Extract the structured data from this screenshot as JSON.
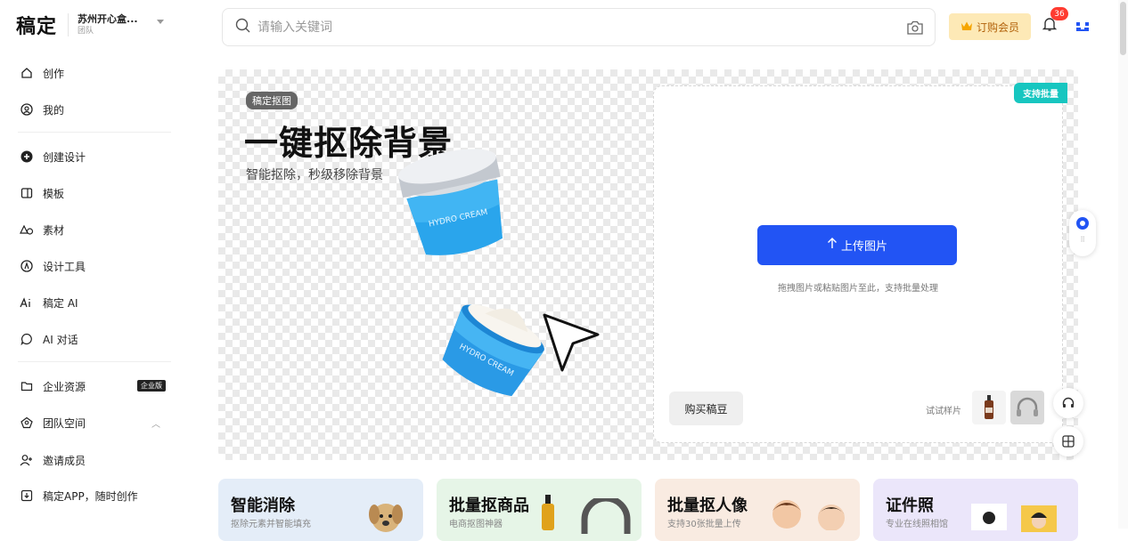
{
  "brand": {
    "logo": "稿定",
    "team_name": "苏州开心盒...",
    "team_type": "团队"
  },
  "sidebar": {
    "items": [
      {
        "label": "创作",
        "icon": "home-icon"
      },
      {
        "label": "我的",
        "icon": "user-circle-icon"
      },
      {
        "label": "创建设计",
        "icon": "plus-circle-icon"
      },
      {
        "label": "模板",
        "icon": "template-icon"
      },
      {
        "label": "素材",
        "icon": "shapes-icon"
      },
      {
        "label": "设计工具",
        "icon": "compass-icon"
      },
      {
        "label": "稿定 AI",
        "icon": "ai-icon"
      },
      {
        "label": "AI 对话",
        "icon": "chat-bubble-icon"
      },
      {
        "label": "企业资源",
        "icon": "folder-icon",
        "badge": "企业版"
      },
      {
        "label": "团队空间",
        "icon": "team-icon"
      },
      {
        "label": "邀请成员",
        "icon": "add-user-icon"
      },
      {
        "label": "稿定APP，随时创作",
        "icon": "download-icon"
      }
    ]
  },
  "search": {
    "placeholder": "请输入关键词"
  },
  "header": {
    "vip_label": "订购会员",
    "notification_count": "36"
  },
  "hero": {
    "tag": "稿定抠图",
    "title": "一键抠除背景",
    "subtitle": "智能抠除，秒级移除背景",
    "batch_tag": "支持批量",
    "upload_label": "上传图片",
    "upload_hint": "拖拽图片或粘贴图片至此，支持批量处理",
    "buy_label": "购买稿豆",
    "sample_label": "试试样片",
    "jar_text": "HYDRO CREAM"
  },
  "cards": [
    {
      "title": "智能消除",
      "subtitle": "抠除元素并智能填充",
      "bg": "#e4edf8"
    },
    {
      "title": "批量抠商品",
      "subtitle": "电商抠图神器",
      "bg": "#e6f5e7"
    },
    {
      "title": "批量抠人像",
      "subtitle": "支持30张批量上传",
      "bg": "#f9ebe1"
    },
    {
      "title": "证件照",
      "subtitle": "专业在线照相馆",
      "bg": "#ebe6fa"
    }
  ],
  "colors": {
    "primary": "#2254f4",
    "vip_bg": "#fde9b6",
    "vip_text": "#b2620b",
    "batch_tag": "#17c6c0",
    "badge_red": "#ff3b30"
  }
}
